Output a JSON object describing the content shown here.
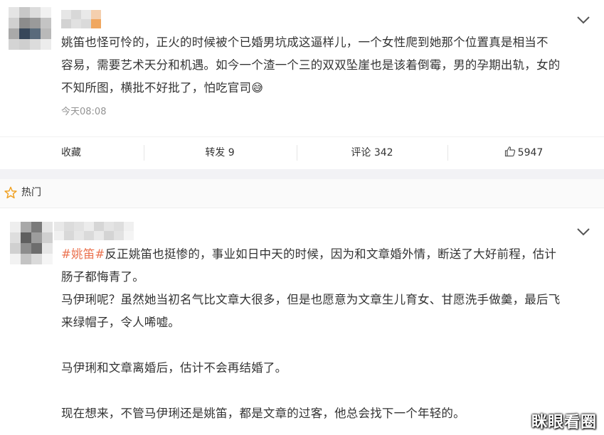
{
  "post1": {
    "lines": [
      "姚笛也怪可怜的，正火的时候被个已婚男坑成这逼样儿，一个女性爬到她那个位置真是相当不",
      "容易，需要艺术天分和机遇。如今一个渣一个三的双双坠崖也是该着倒霉，男的孕期出轨，女的",
      "不知所图，横批不好批了，怕吃官司"
    ],
    "emoji": "😅",
    "time": "今天08:08"
  },
  "actions": {
    "collect": "收藏",
    "repost": "转发 9",
    "comment": "评论 342",
    "like": "5947"
  },
  "hot_section": {
    "label": "热门"
  },
  "post2": {
    "hashtag": "#姚笛#",
    "lines_after_hashtag": "反正姚笛也挺惨的，事业如日中天的时候，因为和文章婚外情，断送了大好前程，估计",
    "line2": "肠子都悔青了。",
    "line3": "马伊琍呢？虽然她当初名气比文章大很多，但是也愿意为文章生儿育女、甘愿洗手做羹，最后飞",
    "line4": "来绿帽子，令人唏嘘。",
    "line5": "马伊琍和文章离婚后，估计不会再结婚了。",
    "line6": "现在想来，不管马伊琍还是姚笛，都是文章的过客，他总会找下一个年轻的。"
  },
  "watermark": "眯眼看圈",
  "colors": {
    "hashtag": "#eb7350",
    "time": "#939393",
    "text": "#333333",
    "section_bg": "#f2f2f5"
  }
}
